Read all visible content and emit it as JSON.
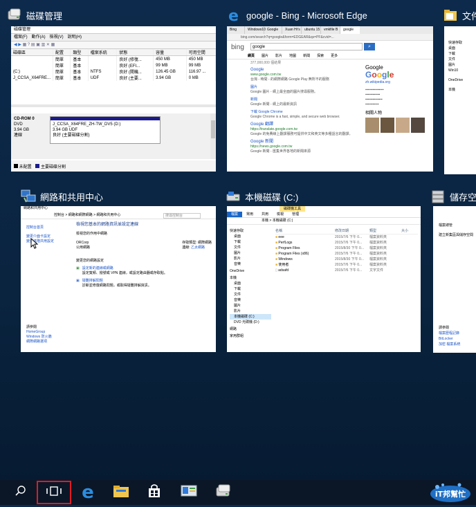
{
  "windows": {
    "disk_mgmt": {
      "title": "磁碟管理",
      "inner_title": "磁碟管理",
      "menu": [
        "檔案(F)",
        "動作(A)",
        "檢視(V)",
        "說明(H)"
      ],
      "columns": [
        "磁碟區",
        "配置",
        "類型",
        "檔案系統",
        "狀態",
        "容量",
        "可用空間"
      ],
      "rows": [
        [
          "",
          "簡單",
          "基本",
          "",
          "良好 (修復...",
          "450 MB",
          "450 MB"
        ],
        [
          "",
          "簡單",
          "基本",
          "",
          "良好 (EFI...",
          "99 MB",
          "99 MB"
        ],
        [
          "(C:)",
          "簡單",
          "基本",
          "NTFS",
          "良好 (開機...",
          "126.45 GB",
          "116.97 ..."
        ],
        [
          "J_CCSA_X64FRE...",
          "簡單",
          "基本",
          "UDF",
          "良好 (主要...",
          "3.94 GB",
          "0 MB"
        ]
      ],
      "disk_label": "CD-ROM 0",
      "disk_type": "DVD",
      "disk_size": "3.94 GB",
      "disk_status": "連線",
      "volume_name": "J_CCSA_X64FRE_ZH-TW_DV5 (D:)",
      "volume_size": "3.94 GB UDF",
      "volume_status": "良好 (主要磁碟分割)",
      "legend": [
        "未配置",
        "主要磁碟分割"
      ]
    },
    "edge": {
      "title": "google - Bing - Microsoft Edge",
      "tabs": [
        "Bing",
        "Windows10",
        "Google",
        "Xuan Hr's",
        "ubuntu 15",
        "vmkfile B",
        "google"
      ],
      "address": "bing.com/search?q=google&form=EDGEAR&qs=PF&cvid=...",
      "search_value": "google",
      "brand": "bing",
      "nav_tabs": [
        "網頁",
        "圖片",
        "影片",
        "地圖",
        "新聞",
        "探索",
        "更多"
      ],
      "results_count": "377,000,000 個結果",
      "results": [
        {
          "title": "Google",
          "url": "www.google.com.tw",
          "desc": "台灣 - 時間 - 的網際網路 Google Play 無所不的服務"
        },
        {
          "title": "圖片",
          "url": "",
          "desc": "Google 圖片 - 網上最全面的圖片搜尋服務。"
        },
        {
          "title": "新聞",
          "url": "",
          "desc": "Google 新聞 - 網上的最新資訊"
        },
        {
          "title": "下載 Google Chrome",
          "url": "",
          "desc": "Google Chrome is a fast, simple, and secure web browser."
        },
        {
          "title": "Google 翻譯",
          "url": "https://translate.google.com.tw",
          "desc": "Google 的免費線上翻譯服務可提供中文和英文等多種語言的翻譯。"
        },
        {
          "title": "Google 新聞",
          "url": "https://news.google.com.tw",
          "desc": "Google 新聞 - 匯集世界各地的新聞來源"
        }
      ],
      "kp_title": "Google",
      "kp_sub": "zh.wikipedia.org",
      "kp_people_title": "相關人物"
    },
    "docs": {
      "title": "文件",
      "sidebar": [
        "快速存取",
        "桌面",
        "下載",
        "文件",
        "圖片",
        "Win10",
        "OneDrive",
        "本機"
      ]
    },
    "network": {
      "title": "網路和共用中心",
      "inner_title": "網路和共用中心",
      "breadcrumb": "控制台 > 網路和網際網路 > 網路和共用中心",
      "search_placeholder": "搜尋控制台",
      "sidebar": [
        "控制台首頁",
        "變更介面卡設定",
        "變更進階共用設定"
      ],
      "heading": "檢視您基本的網路資訊並設定連線",
      "active_label": "檢視您的作用中網路",
      "network_name": "ORCorp",
      "network_type": "公用網路",
      "access_label": "存取類型:",
      "access_value": "網際網路",
      "conn_label": "連線:",
      "conn_value": "乙太網路",
      "change_label": "變更您的網路設定",
      "task1": "設定新的連線或網路",
      "task1_desc": "設定寬頻、撥號或 VPN 連線，或設定路由器或存取點。",
      "task2": "疑難排解問題",
      "task2_desc": "診斷並修復網路問題，或取得疑難排解資訊。",
      "see_also": "請參閱",
      "see_also_items": [
        "HomeGroup",
        "Windows 防火牆",
        "網際網路選項"
      ]
    },
    "explorer": {
      "title": "本機磁碟 (C:)",
      "ribbon_tabs": [
        "檔案",
        "常用",
        "共用",
        "檢視",
        "管理"
      ],
      "ribbon_context": "磁碟機工具",
      "address": "本機 > 本機磁碟 (C:)",
      "columns": [
        "名稱",
        "修改日期",
        "類型",
        "大小"
      ],
      "files": [
        {
          "name": "eee",
          "date": "2015/7/6 下午 0...",
          "type": "檔案資料夾"
        },
        {
          "name": "PerfLogs",
          "date": "2015/7/6 下午 0...",
          "type": "檔案資料夾"
        },
        {
          "name": "Program Files",
          "date": "2015/8/30 下午 0...",
          "type": "檔案資料夾"
        },
        {
          "name": "Program Files (x86)",
          "date": "2015/7/6 下午 0...",
          "type": "檔案資料夾"
        },
        {
          "name": "Windows",
          "date": "2015/8/30 下午 0...",
          "type": "檔案資料夾"
        },
        {
          "name": "使用者",
          "date": "2015/7/6 下午 0...",
          "type": "檔案資料夾"
        },
        {
          "name": "adsafd",
          "date": "2015/7/6 下午 0...",
          "type": "文字文件"
        }
      ],
      "sidebar": [
        "快速存取",
        "桌面",
        "下載",
        "文件",
        "圖片",
        "影片",
        "音樂",
        "OneDrive",
        "本機",
        "桌面",
        "下載",
        "文件",
        "音樂",
        "圖片",
        "影片",
        "本機磁碟 (C:)",
        "DVD 光碟機 (D:)",
        "網路",
        "家用群組"
      ]
    },
    "storage": {
      "title": "儲存空",
      "lines": [
        "檔案總管",
        "建立新集區與儲存空間",
        "請參閱",
        "檔案歷程記錄",
        "BitLocker",
        "加密 檔案系統"
      ]
    }
  },
  "taskbar": {
    "items": [
      "search-icon",
      "task-view-icon",
      "edge-icon",
      "file-explorer-icon",
      "store-icon",
      "control-panel-icon",
      "disk-management-icon"
    ],
    "task_view_active": true
  },
  "watermark": "iT邦幫忙",
  "colors": {
    "desktop": "#0b2643",
    "taskbar": "#0b1727",
    "highlight": "#e81123",
    "link": "#1a55c8"
  }
}
